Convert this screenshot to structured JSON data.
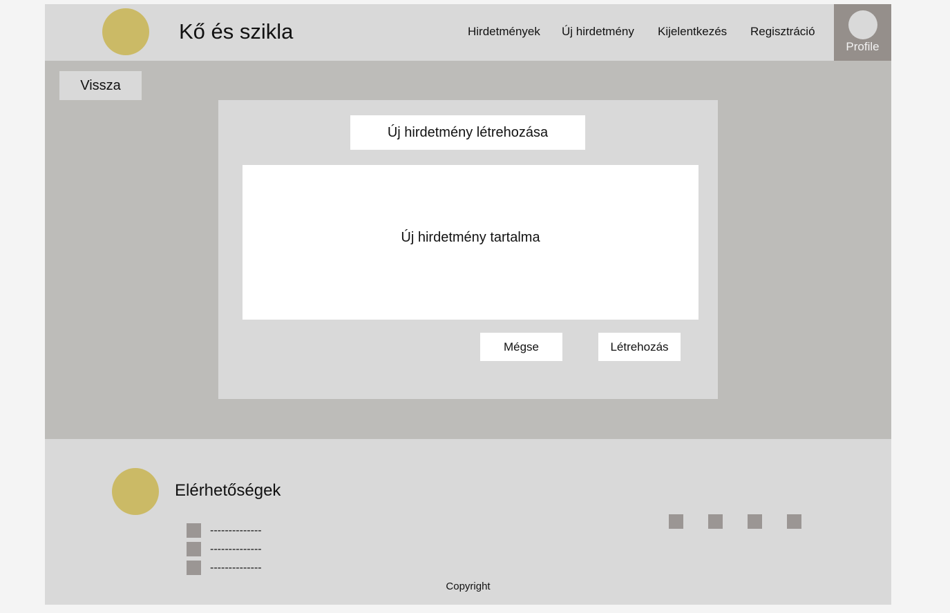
{
  "header": {
    "site_title": "Kő és szikla",
    "nav": [
      "Hirdetmények",
      "Új hirdetmény",
      "Kijelentkezés",
      "Regisztráció"
    ],
    "profile_label": "Profile"
  },
  "main": {
    "back_label": "Vissza",
    "panel": {
      "title": "Új hirdetmény létrehozása",
      "content_placeholder": "Új hirdetmény tartalma",
      "cancel_label": "Mégse",
      "create_label": "Létrehozás"
    }
  },
  "footer": {
    "contact_title": "Elérhetőségek",
    "contacts": [
      "--------------",
      "--------------",
      "--------------"
    ],
    "copyright": "Copyright"
  },
  "colors": {
    "logo": "#cbba66",
    "header_bg": "#d9d9d9",
    "main_bg": "#bdbcb9",
    "profile_bg": "#958f8b",
    "icon_gray": "#9b9694"
  }
}
